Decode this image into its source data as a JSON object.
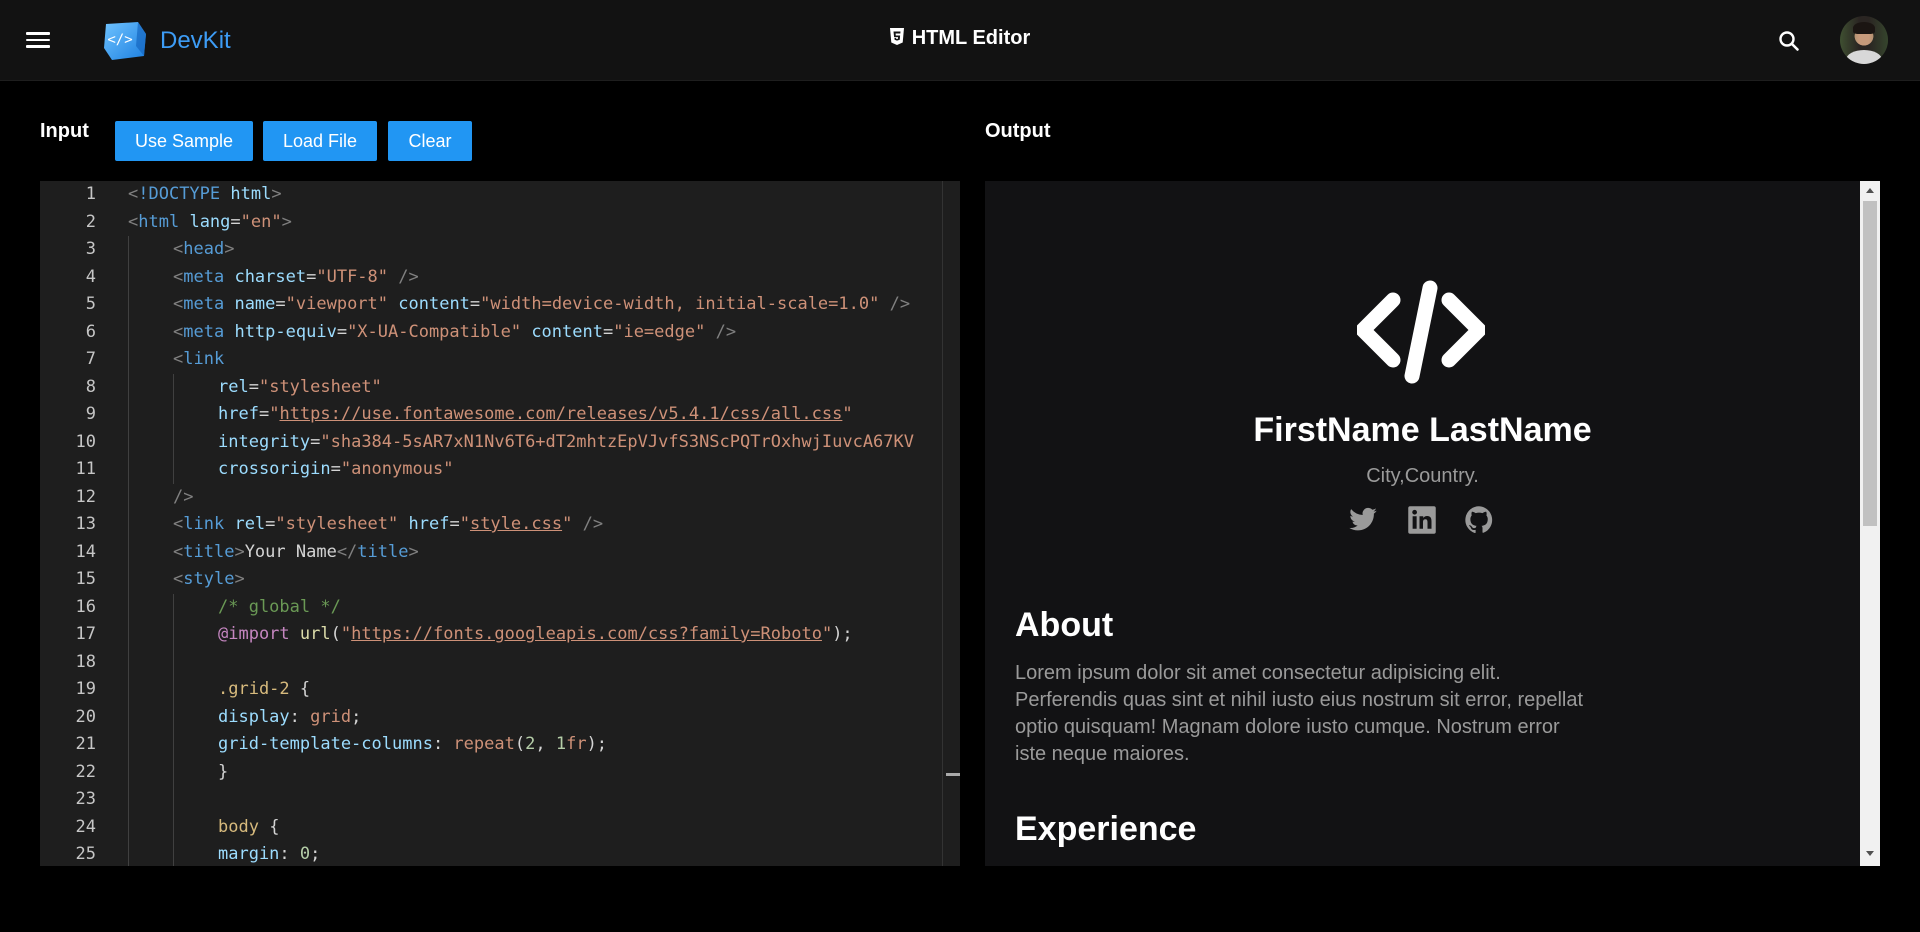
{
  "header": {
    "brand": "DevKit",
    "title": "HTML Editor"
  },
  "input": {
    "label": "Input",
    "buttons": {
      "use_sample": "Use Sample",
      "load_file": "Load File",
      "clear": "Clear"
    }
  },
  "output": {
    "label": "Output"
  },
  "editor": {
    "lines": [
      {
        "n": "1",
        "indent": 0,
        "tokens": [
          [
            "p",
            "<"
          ],
          [
            "t",
            "!DOCTYPE"
          ],
          [
            "w",
            " "
          ],
          [
            "a",
            "html"
          ],
          [
            "p",
            ">"
          ]
        ]
      },
      {
        "n": "2",
        "indent": 0,
        "tokens": [
          [
            "p",
            "<"
          ],
          [
            "t",
            "html"
          ],
          [
            "w",
            " "
          ],
          [
            "a",
            "lang"
          ],
          [
            "w",
            "="
          ],
          [
            "s",
            "\"en\""
          ],
          [
            "p",
            ">"
          ]
        ]
      },
      {
        "n": "3",
        "indent": 1,
        "tokens": [
          [
            "p",
            "<"
          ],
          [
            "t",
            "head"
          ],
          [
            "p",
            ">"
          ]
        ]
      },
      {
        "n": "4",
        "indent": 1,
        "tokens": [
          [
            "p",
            "<"
          ],
          [
            "t",
            "meta"
          ],
          [
            "w",
            " "
          ],
          [
            "a",
            "charset"
          ],
          [
            "w",
            "="
          ],
          [
            "s",
            "\"UTF-8\""
          ],
          [
            "w",
            " "
          ],
          [
            "p",
            "/>"
          ]
        ]
      },
      {
        "n": "5",
        "indent": 1,
        "tokens": [
          [
            "p",
            "<"
          ],
          [
            "t",
            "meta"
          ],
          [
            "w",
            " "
          ],
          [
            "a",
            "name"
          ],
          [
            "w",
            "="
          ],
          [
            "s",
            "\"viewport\""
          ],
          [
            "w",
            " "
          ],
          [
            "a",
            "content"
          ],
          [
            "w",
            "="
          ],
          [
            "s",
            "\"width=device-width, initial-scale=1.0\""
          ],
          [
            "w",
            " "
          ],
          [
            "p",
            "/>"
          ]
        ]
      },
      {
        "n": "6",
        "indent": 1,
        "tokens": [
          [
            "p",
            "<"
          ],
          [
            "t",
            "meta"
          ],
          [
            "w",
            " "
          ],
          [
            "a",
            "http-equiv"
          ],
          [
            "w",
            "="
          ],
          [
            "s",
            "\"X-UA-Compatible\""
          ],
          [
            "w",
            " "
          ],
          [
            "a",
            "content"
          ],
          [
            "w",
            "="
          ],
          [
            "s",
            "\"ie=edge\""
          ],
          [
            "w",
            " "
          ],
          [
            "p",
            "/>"
          ]
        ]
      },
      {
        "n": "7",
        "indent": 1,
        "tokens": [
          [
            "p",
            "<"
          ],
          [
            "t",
            "link"
          ]
        ]
      },
      {
        "n": "8",
        "indent": 2,
        "tokens": [
          [
            "a",
            "rel"
          ],
          [
            "w",
            "="
          ],
          [
            "s",
            "\"stylesheet\""
          ]
        ]
      },
      {
        "n": "9",
        "indent": 2,
        "tokens": [
          [
            "a",
            "href"
          ],
          [
            "w",
            "="
          ],
          [
            "s",
            "\""
          ],
          [
            "u",
            "https://use.fontawesome.com/releases/v5.4.1/css/all.css"
          ],
          [
            "s",
            "\""
          ]
        ]
      },
      {
        "n": "10",
        "indent": 2,
        "tokens": [
          [
            "a",
            "integrity"
          ],
          [
            "w",
            "="
          ],
          [
            "s",
            "\"sha384-5sAR7xN1Nv6T6+dT2mhtzEpVJvfS3NScPQTrOxhwjIuvcA67KV"
          ]
        ]
      },
      {
        "n": "11",
        "indent": 2,
        "tokens": [
          [
            "a",
            "crossorigin"
          ],
          [
            "w",
            "="
          ],
          [
            "s",
            "\"anonymous\""
          ]
        ]
      },
      {
        "n": "12",
        "indent": 1,
        "tokens": [
          [
            "p",
            "/>"
          ]
        ]
      },
      {
        "n": "13",
        "indent": 1,
        "tokens": [
          [
            "p",
            "<"
          ],
          [
            "t",
            "link"
          ],
          [
            "w",
            " "
          ],
          [
            "a",
            "rel"
          ],
          [
            "w",
            "="
          ],
          [
            "s",
            "\"stylesheet\""
          ],
          [
            "w",
            " "
          ],
          [
            "a",
            "href"
          ],
          [
            "w",
            "="
          ],
          [
            "s",
            "\""
          ],
          [
            "u",
            "style.css"
          ],
          [
            "s",
            "\""
          ],
          [
            "w",
            " "
          ],
          [
            "p",
            "/>"
          ]
        ]
      },
      {
        "n": "14",
        "indent": 1,
        "tokens": [
          [
            "p",
            "<"
          ],
          [
            "t",
            "title"
          ],
          [
            "p",
            ">"
          ],
          [
            "w",
            "Your Name"
          ],
          [
            "p",
            "</"
          ],
          [
            "t",
            "title"
          ],
          [
            "p",
            ">"
          ]
        ]
      },
      {
        "n": "15",
        "indent": 1,
        "tokens": [
          [
            "p",
            "<"
          ],
          [
            "t",
            "style"
          ],
          [
            "p",
            ">"
          ]
        ]
      },
      {
        "n": "16",
        "indent": 2,
        "tokens": [
          [
            "c",
            "/* global */"
          ]
        ]
      },
      {
        "n": "17",
        "indent": 2,
        "tokens": [
          [
            "k",
            "@import"
          ],
          [
            "w",
            " "
          ],
          [
            "f",
            "url"
          ],
          [
            "w",
            "("
          ],
          [
            "s",
            "\""
          ],
          [
            "u",
            "https://fonts.googleapis.com/css?family=Roboto"
          ],
          [
            "s",
            "\""
          ],
          [
            "w",
            ");"
          ]
        ]
      },
      {
        "n": "18",
        "indent": 2,
        "tokens": []
      },
      {
        "n": "19",
        "indent": 2,
        "tokens": [
          [
            "sel",
            ".grid-2"
          ],
          [
            "w",
            " {"
          ]
        ]
      },
      {
        "n": "20",
        "indent": 2,
        "tokens": [
          [
            "a",
            "display"
          ],
          [
            "w",
            ": "
          ],
          [
            "s",
            "grid"
          ],
          [
            "w",
            ";"
          ]
        ]
      },
      {
        "n": "21",
        "indent": 2,
        "tokens": [
          [
            "a",
            "grid-template-columns"
          ],
          [
            "w",
            ": "
          ],
          [
            "s",
            "repeat"
          ],
          [
            "w",
            "("
          ],
          [
            "n",
            "2"
          ],
          [
            "w",
            ", "
          ],
          [
            "n",
            "1"
          ],
          [
            "s",
            "fr"
          ],
          [
            "w",
            ");"
          ]
        ]
      },
      {
        "n": "22",
        "indent": 2,
        "tokens": [
          [
            "w",
            "}"
          ]
        ]
      },
      {
        "n": "23",
        "indent": 2,
        "tokens": []
      },
      {
        "n": "24",
        "indent": 2,
        "tokens": [
          [
            "sel",
            "body"
          ],
          [
            "w",
            " {"
          ]
        ]
      },
      {
        "n": "25",
        "indent": 2,
        "tokens": [
          [
            "a",
            "margin"
          ],
          [
            "w",
            ": "
          ],
          [
            "n",
            "0"
          ],
          [
            "w",
            ";"
          ]
        ]
      }
    ]
  },
  "preview": {
    "name": "FirstName LastName",
    "location": "City,Country.",
    "social_icons": [
      "twitter-icon",
      "linkedin-icon",
      "github-icon"
    ],
    "about_heading": "About",
    "about_text": "Lorem ipsum dolor sit amet consectetur adipisicing elit. Perferendis quas sint et nihil iusto eius nostrum sit error, repellat optio quisquam! Magnam dolore iusto cumque. Nostrum error iste neque maiores.",
    "experience_heading": "Experience"
  },
  "colors": {
    "accent": "#2196f3",
    "brand": "#3d9cf5",
    "topbar": "#121212",
    "editor_bg": "#1e1e1e",
    "output_bg": "#121214"
  }
}
